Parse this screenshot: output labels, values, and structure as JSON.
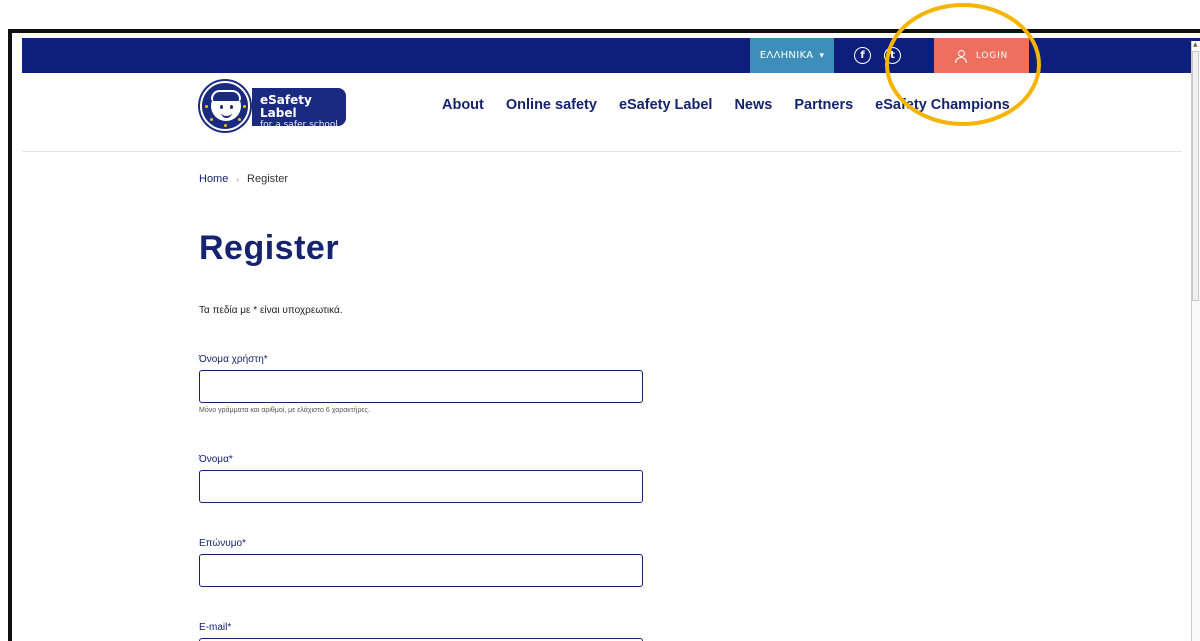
{
  "topbar": {
    "language": "ΕΛΛΗΝΙΚΑ",
    "facebook_glyph": "f",
    "twitter_glyph": "t",
    "login_label": "LOGIN"
  },
  "logo": {
    "title": "eSafety Label",
    "subtitle": "for a safer school"
  },
  "nav": {
    "items": [
      "About",
      "Online safety",
      "eSafety Label",
      "News",
      "Partners",
      "eSafety Champions"
    ]
  },
  "breadcrumb": {
    "home": "Home",
    "current": "Register"
  },
  "page": {
    "title": "Register",
    "required_note": "Τα πεδία με * είναι υποχρεωτικά."
  },
  "form": {
    "username_label": "Όνομα χρήστη*",
    "username_help": "Μόνο γράμματα και αριθμοί, με ελάχιστο 6 χαρακτήρες.",
    "firstname_label": "Όνομα*",
    "lastname_label": "Επώνυμο*",
    "email_label": "E-mail*"
  },
  "colors": {
    "topbar": "#0d1f7a",
    "language_button": "#3d8eb9",
    "login_button": "#ee6f5f",
    "brand_navy": "#16236d",
    "highlight": "#f4b400"
  }
}
